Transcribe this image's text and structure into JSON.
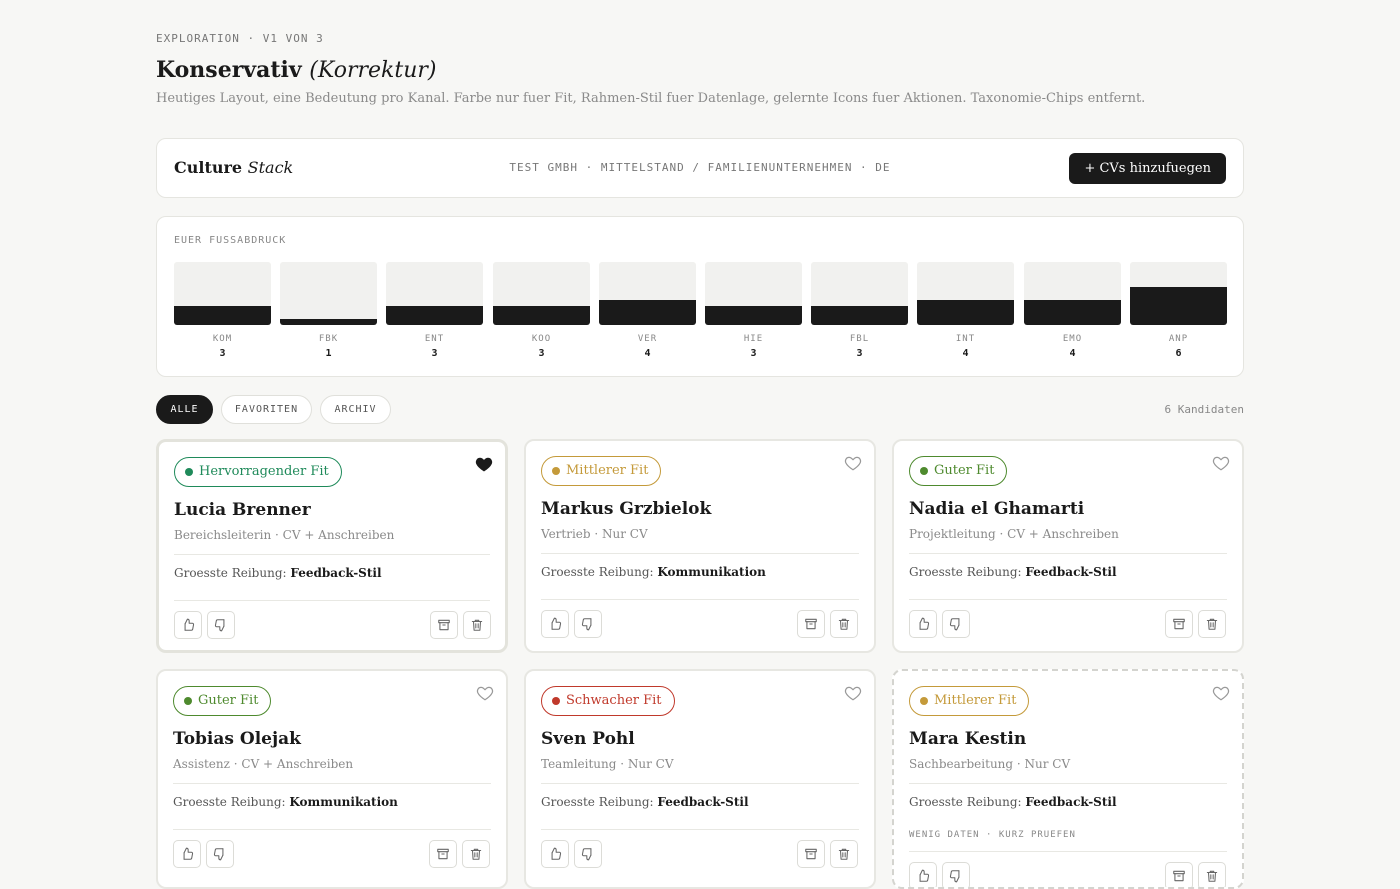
{
  "page": {
    "eyebrow": "EXPLORATION · V1 VON 3",
    "title_main": "Konservativ",
    "title_sub": "(Korrektur)",
    "subtitle": "Heutiges Layout, eine Bedeutung pro Kanal. Farbe nur fuer Fit, Rahmen-Stil fuer Datenlage, gelernte Icons fuer Aktionen. Taxonomie-Chips entfernt."
  },
  "topbar": {
    "brand_main": "Culture",
    "brand_sub": "Stack",
    "company": "TEST GMBH · MITTELSTAND / FAMILIENUNTERNEHMEN · DE",
    "add_button": "+ CVs hinzufuegen"
  },
  "footprint": {
    "label": "EUER FUSSABDRUCK",
    "scale_max": 10,
    "dimensions": [
      {
        "code": "KOM",
        "value": 3
      },
      {
        "code": "FBK",
        "value": 1
      },
      {
        "code": "ENT",
        "value": 3
      },
      {
        "code": "KOO",
        "value": 3
      },
      {
        "code": "VER",
        "value": 4
      },
      {
        "code": "HIE",
        "value": 3
      },
      {
        "code": "FBL",
        "value": 3
      },
      {
        "code": "INT",
        "value": 4
      },
      {
        "code": "EMO",
        "value": 4
      },
      {
        "code": "ANP",
        "value": 6
      }
    ]
  },
  "filters": {
    "tabs": [
      {
        "label": "ALLE",
        "active": true
      },
      {
        "label": "FAVORITEN",
        "active": false
      },
      {
        "label": "ARCHIV",
        "active": false
      }
    ],
    "count": "6 Kandidaten"
  },
  "colors": {
    "fit_excellent": "#1f8a5a",
    "fit_good": "#4e8a2e",
    "fit_medium": "#c49a3a",
    "fit_weak": "#c0392b",
    "ink": "#1a1a1a"
  },
  "friction_label": "Groesste Reibung:",
  "candidates": [
    {
      "fit": "Hervorragender Fit",
      "fit_color": "#1f8a5a",
      "name": "Lucia Brenner",
      "role": "Bereichsleiterin · CV + Anschreiben",
      "friction": "Feedback-Stil",
      "favorite": true,
      "style": "selected",
      "note": ""
    },
    {
      "fit": "Mittlerer Fit",
      "fit_color": "#c49a3a",
      "name": "Markus Grzbielok",
      "role": "Vertrieb · Nur CV",
      "friction": "Kommunikation",
      "favorite": false,
      "style": "normal",
      "note": ""
    },
    {
      "fit": "Guter Fit",
      "fit_color": "#4e8a2e",
      "name": "Nadia el Ghamarti",
      "role": "Projektleitung · CV + Anschreiben",
      "friction": "Feedback-Stil",
      "favorite": false,
      "style": "normal",
      "note": ""
    },
    {
      "fit": "Guter Fit",
      "fit_color": "#4e8a2e",
      "name": "Tobias Olejak",
      "role": "Assistenz · CV + Anschreiben",
      "friction": "Kommunikation",
      "favorite": false,
      "style": "normal",
      "note": ""
    },
    {
      "fit": "Schwacher Fit",
      "fit_color": "#c0392b",
      "name": "Sven Pohl",
      "role": "Teamleitung · Nur CV",
      "friction": "Feedback-Stil",
      "favorite": false,
      "style": "normal",
      "note": ""
    },
    {
      "fit": "Mittlerer Fit",
      "fit_color": "#c49a3a",
      "name": "Mara Kestin",
      "role": "Sachbearbeitung · Nur CV",
      "friction": "Feedback-Stil",
      "favorite": false,
      "style": "dashed",
      "note": "WENIG DATEN · KURZ PRUEFEN"
    }
  ]
}
